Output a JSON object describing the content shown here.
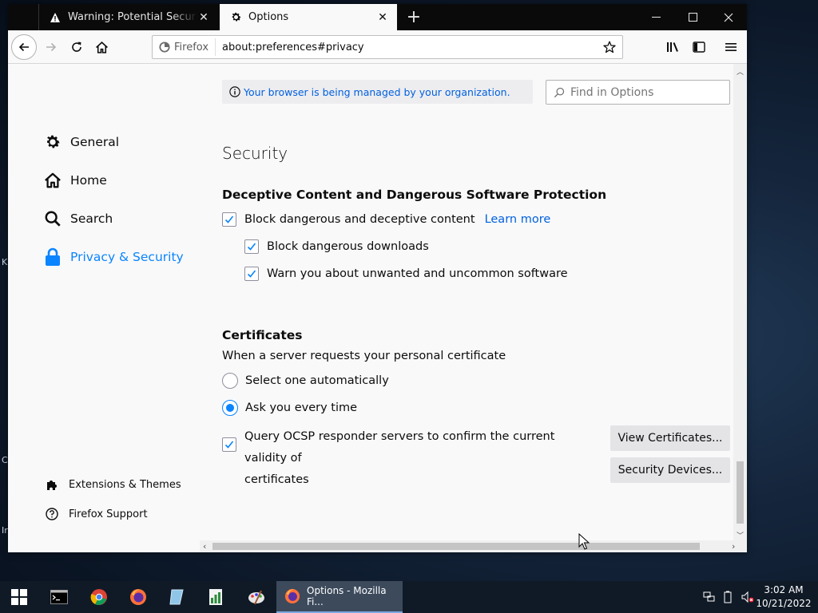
{
  "window": {
    "tabs": [
      {
        "label": "Warning: Potential Security Risk Ahead",
        "active": false
      },
      {
        "label": "Options",
        "active": true
      }
    ]
  },
  "navbar": {
    "identity_label": "Firefox",
    "url": "about:preferences#privacy"
  },
  "notice": {
    "managed_text": "Your browser is being managed by your organization."
  },
  "search": {
    "placeholder": "Find in Options"
  },
  "sidebar": {
    "categories": [
      {
        "label": "General",
        "icon": "gear-icon"
      },
      {
        "label": "Home",
        "icon": "home-icon"
      },
      {
        "label": "Search",
        "icon": "search-icon"
      },
      {
        "label": "Privacy & Security",
        "icon": "lock-icon",
        "selected": true
      }
    ],
    "footer": [
      {
        "label": "Extensions & Themes",
        "icon": "puzzle-icon"
      },
      {
        "label": "Firefox Support",
        "icon": "help-icon"
      }
    ]
  },
  "security": {
    "heading": "Security",
    "deceptive_heading": "Deceptive Content and Dangerous Software Protection",
    "block_dangerous_label": "Block dangerous and deceptive content",
    "learn_more": "Learn more",
    "block_downloads_label": "Block dangerous downloads",
    "warn_unwanted_label": "Warn you about unwanted and uncommon software"
  },
  "certificates": {
    "heading": "Certificates",
    "description": "When a server requests your personal certificate",
    "option_auto": "Select one automatically",
    "option_ask": "Ask you every time",
    "ocsp_line1": "Query OCSP responder servers to confirm the current validity of",
    "ocsp_line2": "certificates",
    "view_button": "View Certificates...",
    "devices_button": "Security Devices..."
  },
  "taskbar": {
    "active_task_label": "Options - Mozilla Fi...",
    "time": "3:02 AM",
    "date": "10/21/2022"
  },
  "colors": {
    "accent": "#0a84ff",
    "link": "#0060df",
    "titlebar": "#0a0a0a"
  }
}
